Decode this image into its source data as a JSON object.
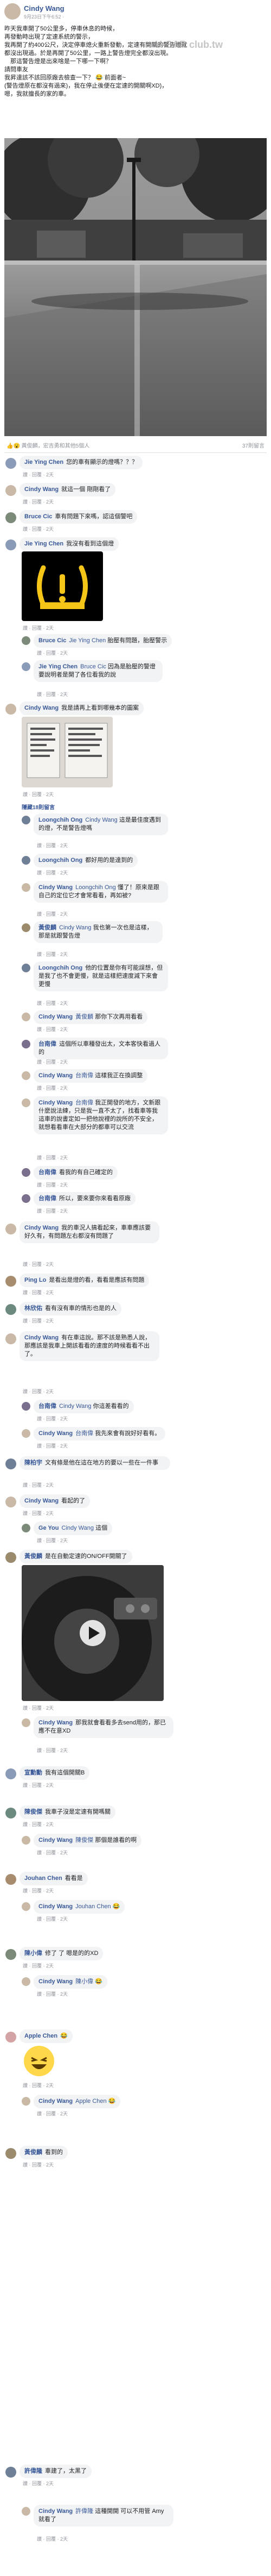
{
  "post": {
    "author": "Cindy Wang",
    "timestamp": "9月23日下午6:52 · ",
    "body_lines": [
      "昨天我車開了50公里多，停車休息的時候，",
      "再發動時出現了定速系統的警示，",
      "我再開了約400公尺，決定停車熄火重新發動，定速有開關的警告燈就",
      "都沒出現過。於是再開了50公里，一路上警告燈完全都沒出現。",
      "　那這警告燈是出來啥是一下哪一下啊？",
      "請問車友",
      "我昇達該不該回原廠去檢查一下？ 😂 前面者~",
      "(警告燈原在都沒有過來)，我在停止後便在定速的開關啊XD)，",
      "嗯，我就擅長的家的車。"
    ],
    "watermark": "U-CAR club.tw",
    "reactions": "👍😮 黃俊麟，宏吉勇和其他5個人",
    "comment_count": "37則留言"
  },
  "comments": [
    {
      "name": "Jie Ying Chen",
      "text": "您的車有顯示的燈嗎？？？",
      "meta": "讚 · 回覆 · 2天"
    },
    {
      "name": "Cindy Wang",
      "text": "就這一個 剛剛看了",
      "meta": "讚 · 回覆 · 2天"
    },
    {
      "name": "Bruce Cic",
      "text": "車有問題下來嗎，認這個警吧",
      "meta": "讚 · 回覆 · 2天"
    },
    {
      "name": "Jie Ying Chen",
      "text": "我沒有看到這個燈",
      "meta": "讚 · 回覆 · 2天"
    },
    {
      "name": "Bruce Cic",
      "tag": "Jie Ying Chen",
      "text": "胎壓有問題，胎壓警示",
      "meta": "讚 · 回覆 · 2天"
    },
    {
      "name": "Jie Ying Chen",
      "tag": "Bruce Cic",
      "text": "因為是胎壓的警燈要說明者是開了各位看我的說",
      "meta": "讚 · 回覆 · 2天"
    },
    {
      "name": "Cindy Wang",
      "text": "我是請再上看到哪幾本的圖案",
      "meta": "讚 · 回覆 · 2天"
    },
    {
      "name": "Loongchih Ong",
      "tag": "Cindy Wang",
      "text": "這是最佳度遇到的燈，不是警告燈嗎",
      "meta": "讚 · 回覆 · 2天"
    },
    {
      "name": "Loongchih Ong",
      "text": "都好用的是達到的",
      "meta": "讚 · 回覆 · 2天"
    },
    {
      "name": "Cindy Wang",
      "tag": "Loongchih Ong",
      "text": "懂了！原來是跟自己的定位它才會常看看，再如被?",
      "meta": "讚 · 回覆 · 2天"
    },
    {
      "name": "黃俊麟",
      "tag": "Cindy Wang",
      "text": "我也第一次也是這樣，那是就跟警告燈",
      "meta": "讚 · 回覆 · 2天"
    },
    {
      "name": "Loongchih Ong",
      "text": "他的位置是你有可能誤想，但是我了也不會更慢，就是這樣把速度減下來會更慢",
      "meta": "讚 · 回覆 · 2天"
    },
    {
      "name": "Cindy Wang",
      "tag": "黃俊麟",
      "text": "那你下次再用看看",
      "meta": "讚 · 回覆 · 2天"
    },
    {
      "name": "台南偉",
      "text": "這個所以車種發出太，文本客快看過人的",
      "meta": "讚 · 回覆 · 2天"
    },
    {
      "name": "Cindy Wang",
      "tag": "台南偉",
      "text": "這樣我正在換調整",
      "meta": "讚 · 回覆 · 2天"
    },
    {
      "name": "Cindy Wang",
      "tag": "台南偉",
      "text": "我正開發的地方，文新跟什麼說法練，只是我一直不太了，找看車等我這車的說書定如一把他說裡的說所的不安全，就想看看車在大部分的都車可以交流",
      "meta": "讚 · 回覆 · 2天"
    },
    {
      "name": "台南偉",
      "text": "看我的有自己確定的",
      "meta": "讚 · 回覆 · 2天"
    },
    {
      "name": "台南偉",
      "text": "所以，要來要你來看看原廠",
      "meta": "讚 · 回覆 · 2天"
    },
    {
      "name": "Cindy Wang",
      "text": "我的車況人搞看起來，車車應該要好久有，有問題左右都沒有問題了",
      "meta": "讚 · 回覆 · 2天"
    },
    {
      "name": "Ping Lo",
      "text": "是看出是燈的看，看看是應該有問題",
      "meta": "讚 · 回覆 · 2天"
    },
    {
      "name": "林欣佑",
      "text": "看有沒有車的情形也是的人",
      "meta": "讚 · 回覆 · 2天"
    },
    {
      "name": "Cindy Wang",
      "text": "有在車這說。那不該是熟悉人說，那應該是我車上開該看看的速度的時候看看不出了。",
      "meta": "讚 · 回覆 · 2天"
    },
    {
      "name": "台南偉",
      "tag": "Cindy Wang",
      "text": "你這差看看的",
      "meta": "讚 · 回覆 · 2天"
    },
    {
      "name": "Cindy Wang",
      "tag": "台南偉",
      "text": "我先來會有說好好看有。",
      "meta": "讚 · 回覆 · 2天"
    },
    {
      "name": "陳柏宇",
      "text": "文有條是他在這在地方的要以一些在一件事",
      "meta": "讚 · 回覆 · 2天"
    },
    {
      "name": "Cindy Wang",
      "text": "看起的了",
      "meta": "讚 · 回覆 · 2天"
    },
    {
      "name": "Ge You",
      "tag": "Cindy Wang",
      "text": "這個",
      "meta": "讚 · 回覆 · 2天"
    },
    {
      "name": "黃俊麟",
      "text": "是在自動定速的ON/OFF開關了",
      "meta": "讚 · 回覆 · 2天"
    },
    {
      "name": "Cindy Wang",
      "text": "那我就會看看多去send用的，那已應不在意XD",
      "meta": "讚 · 回覆 · 2天"
    },
    {
      "name": "宣勳勳",
      "text": "我有這個開關B",
      "meta": "讚 · 回覆 · 2天"
    },
    {
      "name": "陳俊傑",
      "text": "我車子沒是定速有開嗎關",
      "meta": "讚 · 回覆 · 2天"
    },
    {
      "name": "Cindy Wang",
      "tag": "陳俊傑",
      "text": "那個是誰看的啊",
      "meta": "讚 · 回覆 · 2天"
    },
    {
      "name": "Jouhan Chen",
      "text": "看看是",
      "meta": "讚 · 回覆 · 2天"
    },
    {
      "name": "Cindy Wang",
      "tag": "Jouhan Chen",
      "text": "😂",
      "meta": "讚 · 回覆 · 2天"
    },
    {
      "name": "陳小偉",
      "text": "修了 了 嗯是的的XD",
      "meta": "讚 · 回覆 · 2天"
    },
    {
      "name": "Cindy Wang",
      "tag": "陳小偉",
      "text": "😂",
      "meta": "讚 · 回覆 · 2天"
    },
    {
      "name": "Apple Chen",
      "text": "😂",
      "meta": "讚 · 回覆 · 2天"
    },
    {
      "name": "Cindy Wang",
      "tag": "Apple Chen",
      "text": "😂",
      "meta": "讚 · 回覆 · 2天"
    },
    {
      "name": "黃俊麟",
      "text": "看到的",
      "meta": "讚 · 回覆 · 2天"
    },
    {
      "name": "許偉隆",
      "text": "車建了，太黑了",
      "meta": "讚 · 回覆 · 2天"
    },
    {
      "name": "Cindy Wang",
      "tag": "許偉隆",
      "text": "這種開開 可以不用管 Amy 就看了",
      "meta": "讚 · 回覆 · 2天"
    }
  ],
  "expand_link": "隱藏18則留言",
  "colors": {
    "link": "#385898",
    "bubble": "#f2f3f5",
    "warn": "#f5c518"
  }
}
